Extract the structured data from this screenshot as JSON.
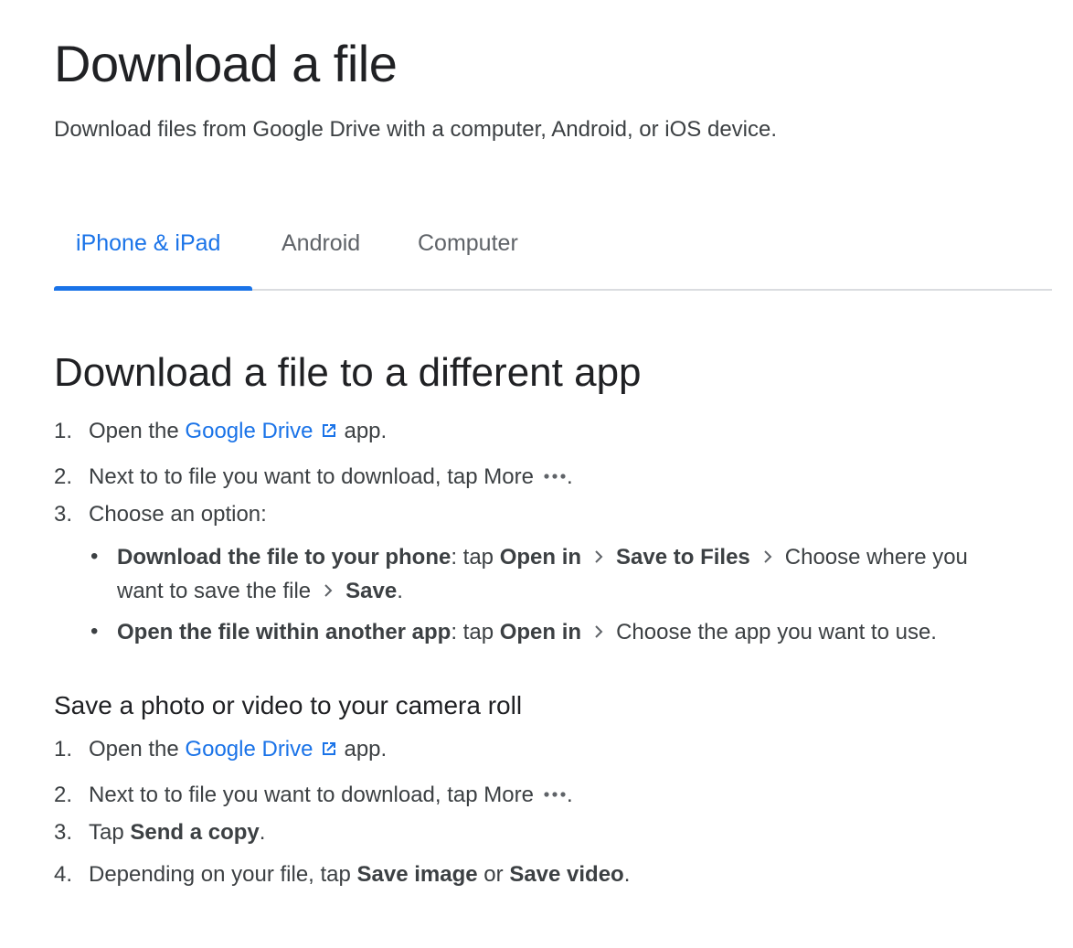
{
  "page_title": "Download a file",
  "subtitle": "Download files from Google Drive with a computer, Android, or iOS device.",
  "tabs": [
    {
      "label": "iPhone & iPad",
      "active": true
    },
    {
      "label": "Android",
      "active": false
    },
    {
      "label": "Computer",
      "active": false
    }
  ],
  "section1": {
    "title": "Download a file to a different app",
    "steps": {
      "s1": {
        "num": "1.",
        "pre": "Open the ",
        "link": "Google Drive",
        "post": "app."
      },
      "s2": {
        "num": "2.",
        "text": "Next to to file you want to download, tap More",
        "post": "."
      },
      "s3": {
        "num": "3.",
        "text": "Choose an option:"
      }
    },
    "bullets": {
      "b1": {
        "bold1": "Download the file to your phone",
        "text1": ": tap ",
        "bold2": "Open in",
        "bold3": "Save to Files",
        "text2": "Choose where you",
        "text3": "want to save the file",
        "bold4": "Save",
        "text4": "."
      },
      "b2": {
        "bold1": "Open the file within another app",
        "text1": ": tap ",
        "bold2": "Open in",
        "text2": "Choose the app you want to use."
      }
    }
  },
  "section2": {
    "title": "Save a photo or video to your camera roll",
    "steps": {
      "s1": {
        "num": "1.",
        "pre": "Open the ",
        "link": "Google Drive",
        "post": "app."
      },
      "s2": {
        "num": "2.",
        "text": "Next to to file you want to download, tap More",
        "post": "."
      },
      "s3": {
        "num": "3.",
        "pre": "Tap ",
        "bold": "Send a copy",
        "post": "."
      },
      "s4": {
        "num": "4.",
        "pre": "Depending on your file, tap ",
        "bold1": "Save image",
        "mid": " or ",
        "bold2": "Save video",
        "post": "."
      }
    }
  },
  "colors": {
    "accent": "#1a73e8",
    "text": "#3c4043",
    "heading": "#202124",
    "inactive_tab": "#5f6368",
    "divider": "#dadce0"
  },
  "icons": {
    "external_link": "external-link-icon",
    "more": "more-horiz-icon",
    "chevron": "chevron-right-icon"
  }
}
